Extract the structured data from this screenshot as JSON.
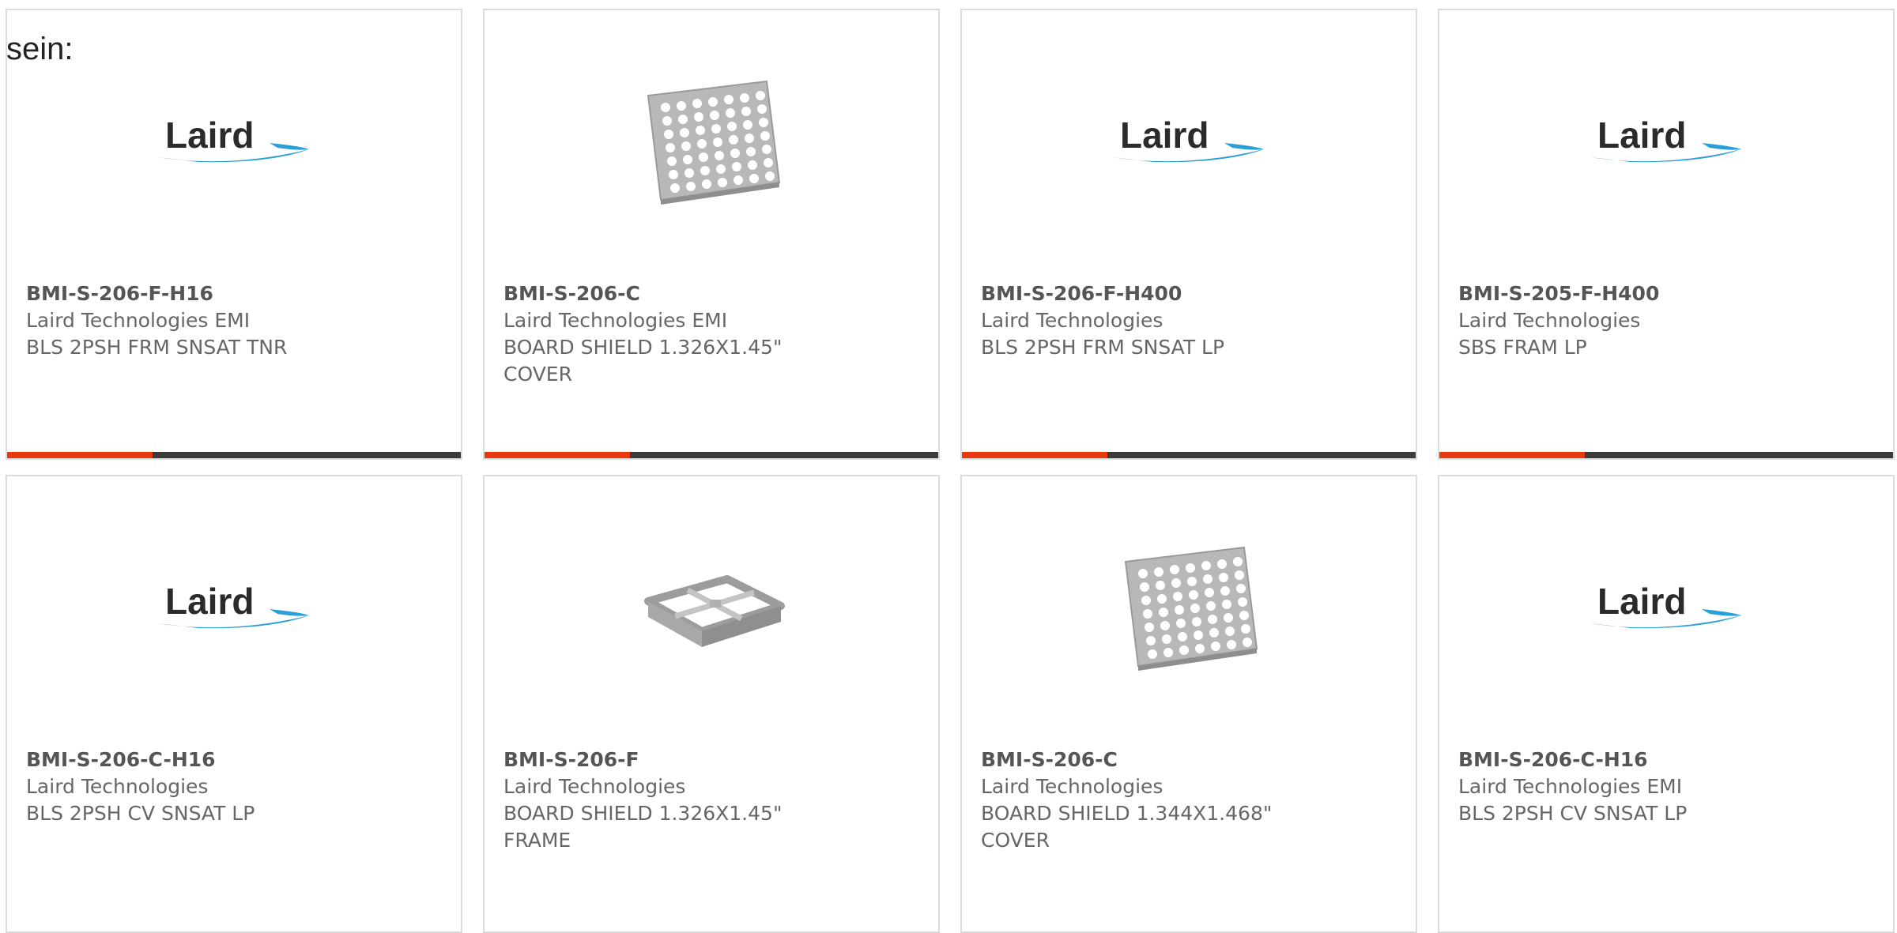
{
  "intro_text": "sein:",
  "colors": {
    "accent": "#e8380d",
    "bar_dark": "#3b3b3b",
    "laird_blue": "#2a9fd6",
    "card_border": "#dcdcdc",
    "text": "#666666"
  },
  "products": [
    {
      "part_no": "BMI-S-206-F-H16",
      "manufacturer": "Laird Technologies EMI",
      "description": "BLS 2PSH FRM SNSAT TNR",
      "image": "laird-logo",
      "logo_text": "Laird"
    },
    {
      "part_no": "BMI-S-206-C",
      "manufacturer": "Laird Technologies EMI",
      "description": "BOARD SHIELD 1.326X1.45\"\nCOVER",
      "image": "perforated-cover-photo",
      "logo_text": ""
    },
    {
      "part_no": "BMI-S-206-F-H400",
      "manufacturer": "Laird Technologies",
      "description": "BLS 2PSH FRM SNSAT LP",
      "image": "laird-logo",
      "logo_text": "Laird"
    },
    {
      "part_no": "BMI-S-205-F-H400",
      "manufacturer": "Laird Technologies",
      "description": "SBS FRAM LP",
      "image": "laird-logo",
      "logo_text": "Laird"
    },
    {
      "part_no": "BMI-S-206-C-H16",
      "manufacturer": "Laird Technologies",
      "description": "BLS 2PSH CV SNSAT LP",
      "image": "laird-logo",
      "logo_text": "Laird"
    },
    {
      "part_no": "BMI-S-206-F",
      "manufacturer": "Laird Technologies",
      "description": "BOARD SHIELD 1.326X1.45\"\nFRAME",
      "image": "shield-frame-photo",
      "logo_text": ""
    },
    {
      "part_no": "BMI-S-206-C",
      "manufacturer": "Laird Technologies",
      "description": "BOARD SHIELD 1.344X1.468\"\nCOVER",
      "image": "perforated-cover-photo",
      "logo_text": ""
    },
    {
      "part_no": "BMI-S-206-C-H16",
      "manufacturer": "Laird Technologies EMI",
      "description": "BLS 2PSH CV SNSAT LP",
      "image": "laird-logo",
      "logo_text": "Laird"
    }
  ]
}
